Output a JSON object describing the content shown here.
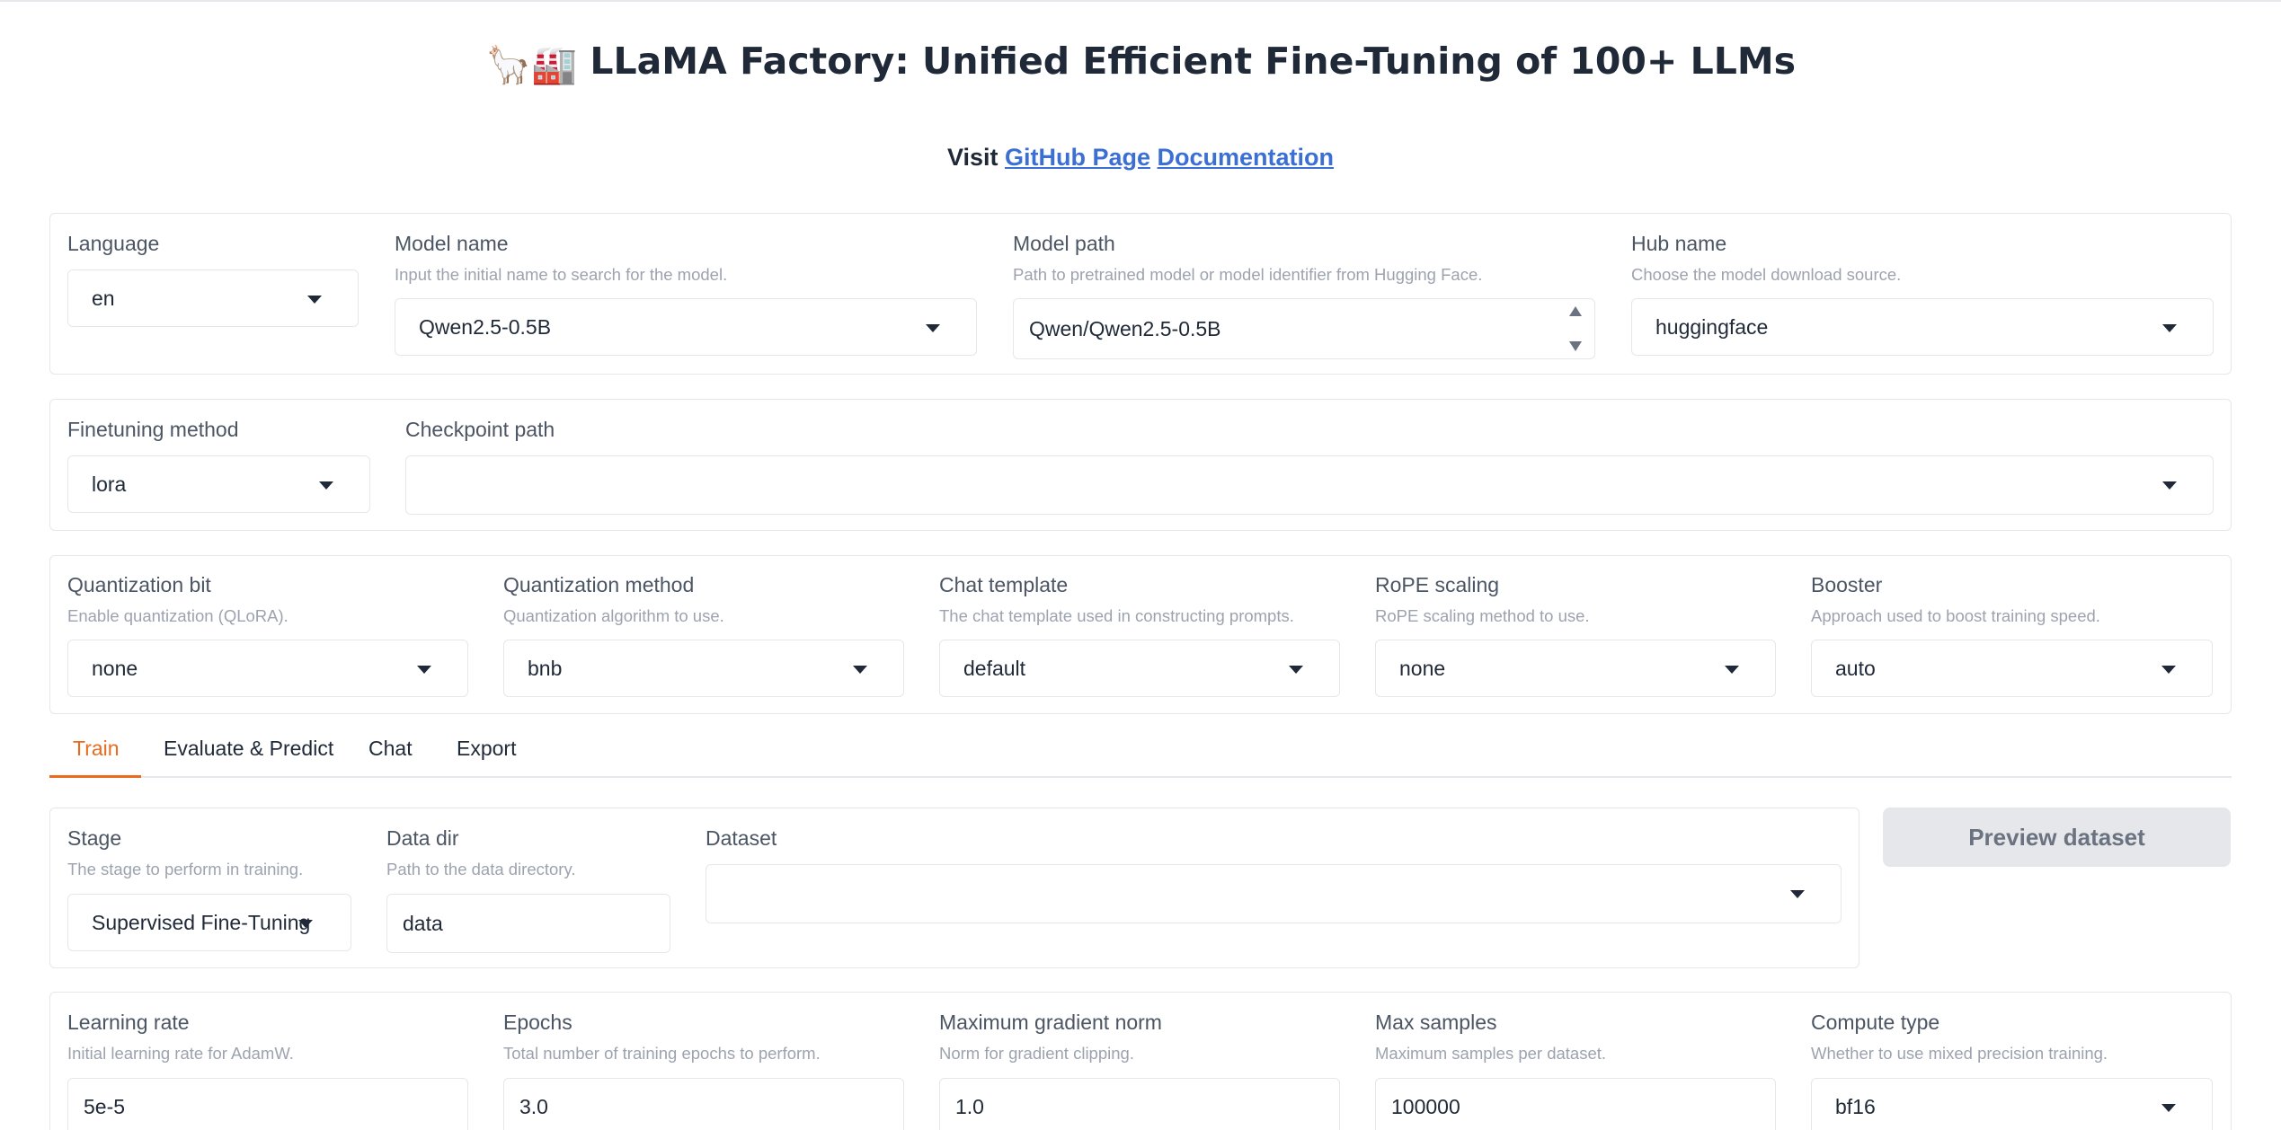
{
  "app": {
    "title_emoji": "🦙🏭",
    "title": "LLaMA Factory: Unified Efficient Fine-Tuning of 100+ LLMs",
    "visit_text": "Visit",
    "github_link": "GitHub Page",
    "docs_link": "Documentation"
  },
  "top": {
    "language": {
      "label": "Language",
      "value": "en"
    },
    "model_name": {
      "label": "Model name",
      "info": "Input the initial name to search for the model.",
      "value": "Qwen2.5-0.5B"
    },
    "model_path": {
      "label": "Model path",
      "info": "Path to pretrained model or model identifier from Hugging Face.",
      "value": "Qwen/Qwen2.5-0.5B"
    },
    "hub_name": {
      "label": "Hub name",
      "info": "Choose the model download source.",
      "value": "huggingface"
    }
  },
  "finetune": {
    "method": {
      "label": "Finetuning method",
      "value": "lora"
    },
    "checkpoint": {
      "label": "Checkpoint path",
      "value": ""
    }
  },
  "advanced": {
    "quant_bit": {
      "label": "Quantization bit",
      "info": "Enable quantization (QLoRA).",
      "value": "none"
    },
    "quant_method": {
      "label": "Quantization method",
      "info": "Quantization algorithm to use.",
      "value": "bnb"
    },
    "chat_template": {
      "label": "Chat template",
      "info": "The chat template used in constructing prompts.",
      "value": "default"
    },
    "rope_scaling": {
      "label": "RoPE scaling",
      "info": "RoPE scaling method to use.",
      "value": "none"
    },
    "booster": {
      "label": "Booster",
      "info": "Approach used to boost training speed.",
      "value": "auto"
    }
  },
  "tabs": [
    "Train",
    "Evaluate & Predict",
    "Chat",
    "Export"
  ],
  "train": {
    "stage": {
      "label": "Stage",
      "info": "The stage to perform in training.",
      "value": "Supervised Fine-Tuning"
    },
    "data_dir": {
      "label": "Data dir",
      "info": "Path to the data directory.",
      "value": "data"
    },
    "dataset": {
      "label": "Dataset",
      "value": ""
    },
    "preview_button": "Preview dataset",
    "learning_rate": {
      "label": "Learning rate",
      "info": "Initial learning rate for AdamW.",
      "value": "5e-5"
    },
    "epochs": {
      "label": "Epochs",
      "info": "Total number of training epochs to perform.",
      "value": "3.0"
    },
    "max_grad_norm": {
      "label": "Maximum gradient norm",
      "info": "Norm for gradient clipping.",
      "value": "1.0"
    },
    "max_samples": {
      "label": "Max samples",
      "info": "Maximum samples per dataset.",
      "value": "100000"
    },
    "compute_type": {
      "label": "Compute type",
      "info": "Whether to use mixed precision training.",
      "value": "bf16"
    }
  },
  "colors": {
    "accent": "#ea6a1e",
    "link": "#3b6fd4",
    "border": "#e5e7eb"
  }
}
